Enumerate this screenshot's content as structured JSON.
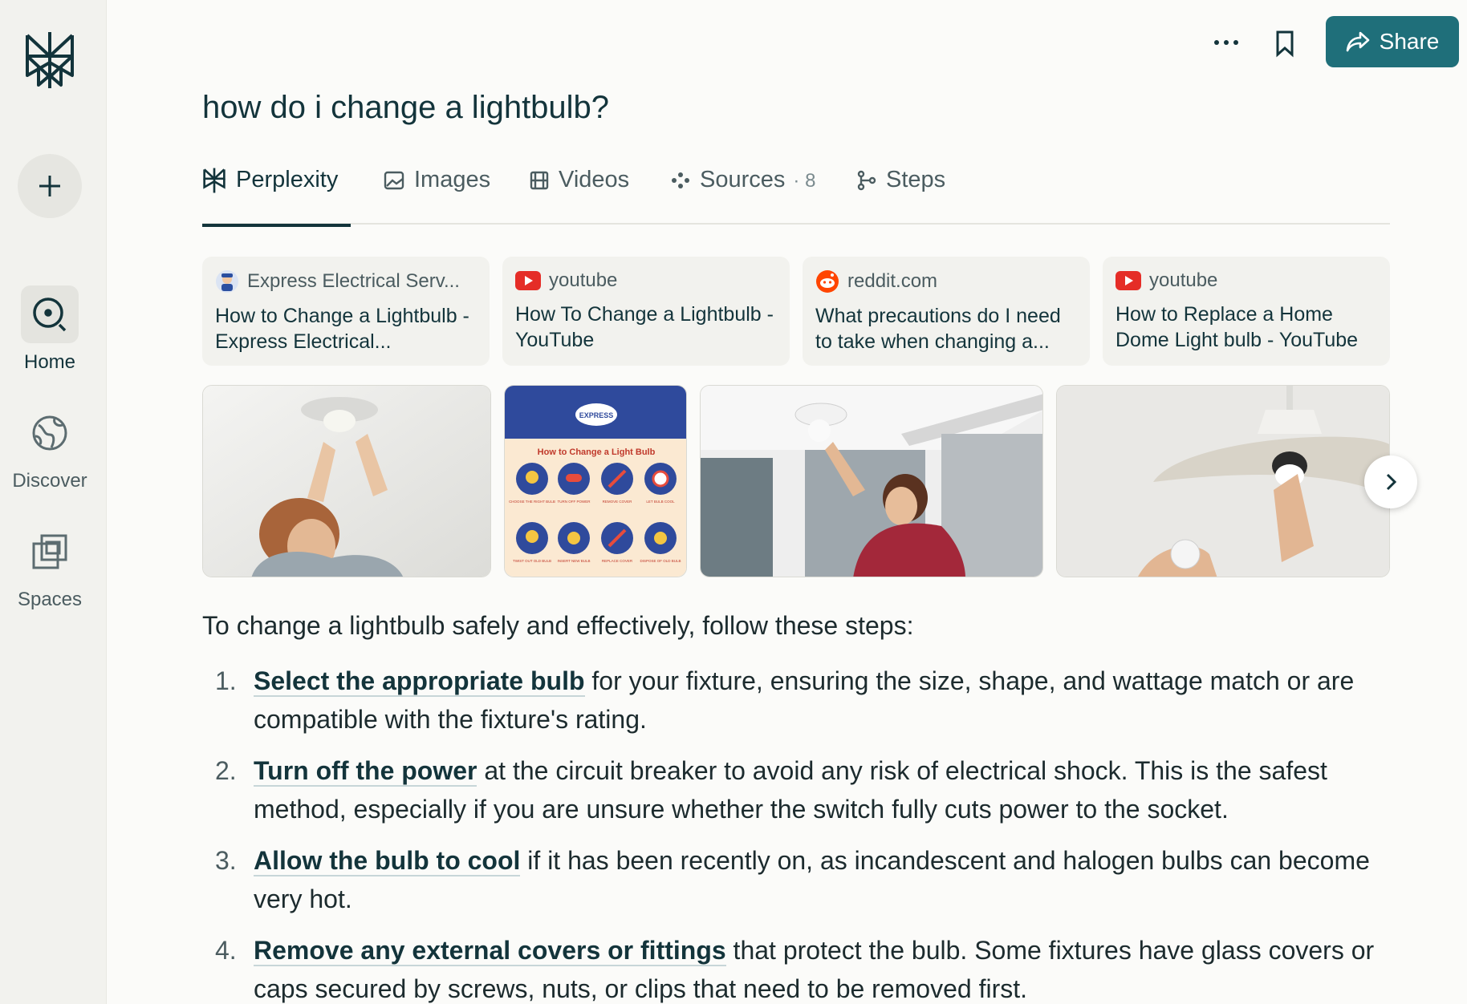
{
  "sidebar": {
    "items": [
      {
        "label": "Home",
        "icon": "home-search-icon",
        "active": true
      },
      {
        "label": "Discover",
        "icon": "globe-icon",
        "active": false
      },
      {
        "label": "Spaces",
        "icon": "spaces-icon",
        "active": false
      }
    ]
  },
  "topbar": {
    "share_label": "Share"
  },
  "query": "how do i change a lightbulb?",
  "tabs": [
    {
      "label": "Perplexity",
      "icon": "perplexity-logo-icon",
      "active": true
    },
    {
      "label": "Images",
      "icon": "image-icon"
    },
    {
      "label": "Videos",
      "icon": "film-icon"
    },
    {
      "label": "Sources",
      "icon": "sources-icon",
      "count": "8"
    },
    {
      "label": "Steps",
      "icon": "steps-icon"
    }
  ],
  "sources": [
    {
      "site": "Express Electrical Serv...",
      "title": "How to Change a Lightbulb - Express Electrical...",
      "icon": "electrician-favicon"
    },
    {
      "site": "youtube",
      "title": "How To Change a Lightbulb - YouTube",
      "icon": "youtube-favicon"
    },
    {
      "site": "reddit.com",
      "title": "What precautions do I need to take when changing a...",
      "icon": "reddit-favicon"
    },
    {
      "site": "youtube",
      "title": "How to Replace a Home Dome Light bulb - YouTube",
      "icon": "youtube-favicon"
    }
  ],
  "infographic": {
    "brand": "EXPRESS",
    "title": "How to Change a Light Bulb",
    "steps": [
      "CHOOSE THE RIGHT BULB",
      "TURN OFF POWER",
      "REMOVE COVER",
      "LET BULB COOL",
      "TWIST OUT OLD BULB",
      "INSERT NEW BULB",
      "REPLACE COVER",
      "DISPOSE OF OLD BULB"
    ]
  },
  "answer": {
    "intro": "To change a lightbulb safely and effectively, follow these steps:",
    "steps": [
      {
        "num": "1.",
        "bold": "Select the appropriate bulb",
        "rest": " for your fixture, ensuring the size, shape, and wattage match or are compatible with the fixture's rating."
      },
      {
        "num": "2.",
        "bold": "Turn off the power",
        "rest": " at the circuit breaker to avoid any risk of electrical shock. This is the safest method, especially if you are unsure whether the switch fully cuts power to the socket."
      },
      {
        "num": "3.",
        "bold": "Allow the bulb to cool",
        "rest": " if it has been recently on, as incandescent and halogen bulbs can become very hot."
      },
      {
        "num": "4.",
        "bold": "Remove any external covers or fittings",
        "rest": " that protect the bulb. Some fixtures have glass covers or caps secured by screws, nuts, or clips that need to be removed first."
      }
    ]
  },
  "colors": {
    "accent": "#1f6f7a",
    "text": "#13343b",
    "sidebar_bg": "#f2f2ee",
    "page_bg": "#fbfbf9"
  }
}
